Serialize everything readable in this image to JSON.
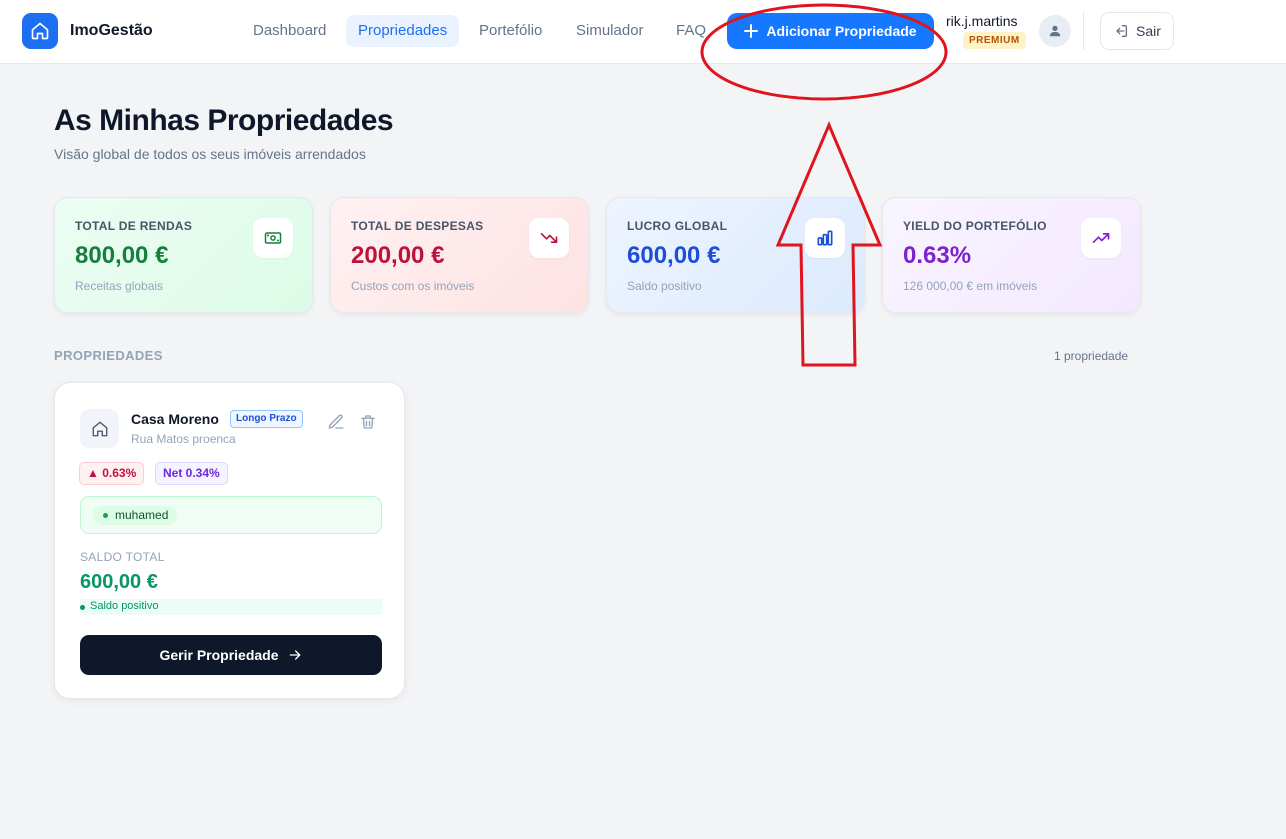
{
  "brand": {
    "name": "ImoGestão"
  },
  "nav": {
    "items": [
      {
        "label": "Dashboard"
      },
      {
        "label": "Propriedades"
      },
      {
        "label": "Portefólio"
      },
      {
        "label": "Simulador"
      },
      {
        "label": "FAQ"
      }
    ],
    "active": "Propriedades"
  },
  "header": {
    "add_label": "Adicionar Propriedade",
    "username": "rik.j.martins",
    "plan_badge": "PREMIUM",
    "logout_label": "Sair"
  },
  "page": {
    "title": "As Minhas Propriedades",
    "subtitle": "Visão global de todos os seus imóveis arrendados"
  },
  "stats": [
    {
      "label": "TOTAL DE RENDAS",
      "value": "800,00 €",
      "sub": "Receitas globais",
      "color": "#15803d",
      "icon": "money-icon"
    },
    {
      "label": "TOTAL DE DESPESAS",
      "value": "200,00 €",
      "sub": "Custos com os imóveis",
      "color": "#be123c",
      "icon": "trending-down-icon"
    },
    {
      "label": "LUCRO GLOBAL",
      "value": "600,00 €",
      "sub": "Saldo positivo",
      "color": "#1d4ed8",
      "icon": "bar-chart-icon"
    },
    {
      "label": "YIELD DO PORTEFÓLIO",
      "value": "0.63%",
      "sub": "126 000,00 € em imóveis",
      "color": "#7e22ce",
      "icon": "trending-up-icon"
    }
  ],
  "properties_section": {
    "label": "PROPRIEDADES",
    "count": "1 propriedade"
  },
  "property": {
    "name": "Casa Moreno",
    "term": "Longo Prazo",
    "address": "Rua Matos proenca",
    "yield_gross": "▲ 0.63%",
    "yield_net": "Net 0.34%",
    "tenant": "muhamed",
    "balance_label": "SALDO TOTAL",
    "balance_value": "600,00 €",
    "balance_note": "Saldo positivo",
    "manage_label": "Gerir Propriedade"
  },
  "colors": {
    "accent": "#1677ff",
    "annotation": "#e0141e"
  }
}
